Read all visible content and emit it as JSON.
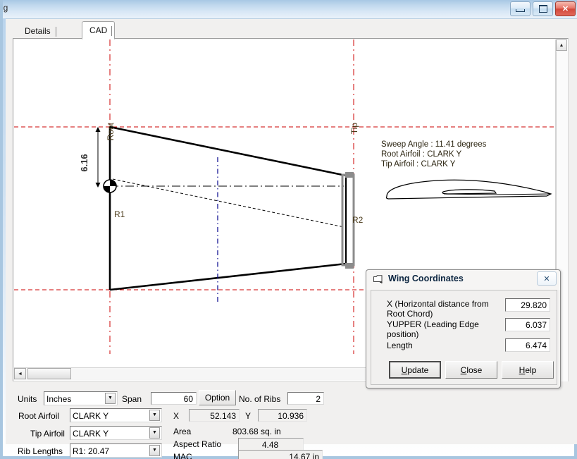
{
  "window": {
    "title": "ng",
    "minimize_label": "minimize",
    "maximize_label": "maximize",
    "close_label": "✕"
  },
  "tabs": [
    {
      "label": "Details",
      "active": false
    },
    {
      "label": "CAD",
      "active": true
    }
  ],
  "cad": {
    "root_label": "Root",
    "tip_label": "Tip",
    "rib1_label": "R1",
    "rib2_label": "R2",
    "height_dim": "6.16",
    "annotations": {
      "sweep": "Sweep Angle : 11.41 degrees",
      "root_airfoil": "Root Airfoil : CLARK Y",
      "tip_airfoil": "Tip Airfoil   : CLARK Y"
    },
    "scroll": {
      "up_arrow": "▲",
      "left_arrow": "◄"
    }
  },
  "form": {
    "units_label": "Units",
    "units_value": "Inches",
    "span_label": "Span",
    "span_value": "60",
    "option_button": "Option",
    "ribs_label": "No. of Ribs",
    "ribs_value": "2",
    "root_airfoil_label": "Root Airfoil",
    "root_airfoil_value": "CLARK Y",
    "tip_airfoil_label": "Tip Airfoil",
    "tip_airfoil_value": "CLARK Y",
    "rib_lengths_label": "Rib Lengths",
    "rib_lengths_value": "R1: 20.47",
    "x_label": "X",
    "x_value": "52.143",
    "y_label": "Y",
    "y_value": "10.936",
    "area_label": "Area",
    "area_value": "803.68 sq. in",
    "aspect_ratio_label": "Aspect Ratio",
    "aspect_ratio_value": "4.48",
    "mac_label": "MAC",
    "mac_value": "14.67 in",
    "combo_arrow": "▼"
  },
  "dialog": {
    "title": "Wing Coordinates",
    "close_label": "✕",
    "fields": [
      {
        "label": "X (Horizontal distance from Root Chord)",
        "value": "29.820"
      },
      {
        "label": "YUPPER (Leading Edge position)",
        "value": "6.037"
      },
      {
        "label": "Length",
        "value": "6.474"
      }
    ],
    "buttons": [
      {
        "label": "Update",
        "accel": "U",
        "rest": "pdate",
        "default": true
      },
      {
        "label": "Close",
        "accel": "C",
        "rest": "lose",
        "default": false
      },
      {
        "label": "Help",
        "accel": "H",
        "rest": "elp",
        "default": false
      }
    ]
  },
  "colors": {
    "titlebar_blue": "#c2d9ee",
    "dimension_red": "#cc0000",
    "centerline_blue": "#00008b",
    "handle_gray": "#8c8c8c",
    "dialog_face": "#f1f0ef"
  }
}
